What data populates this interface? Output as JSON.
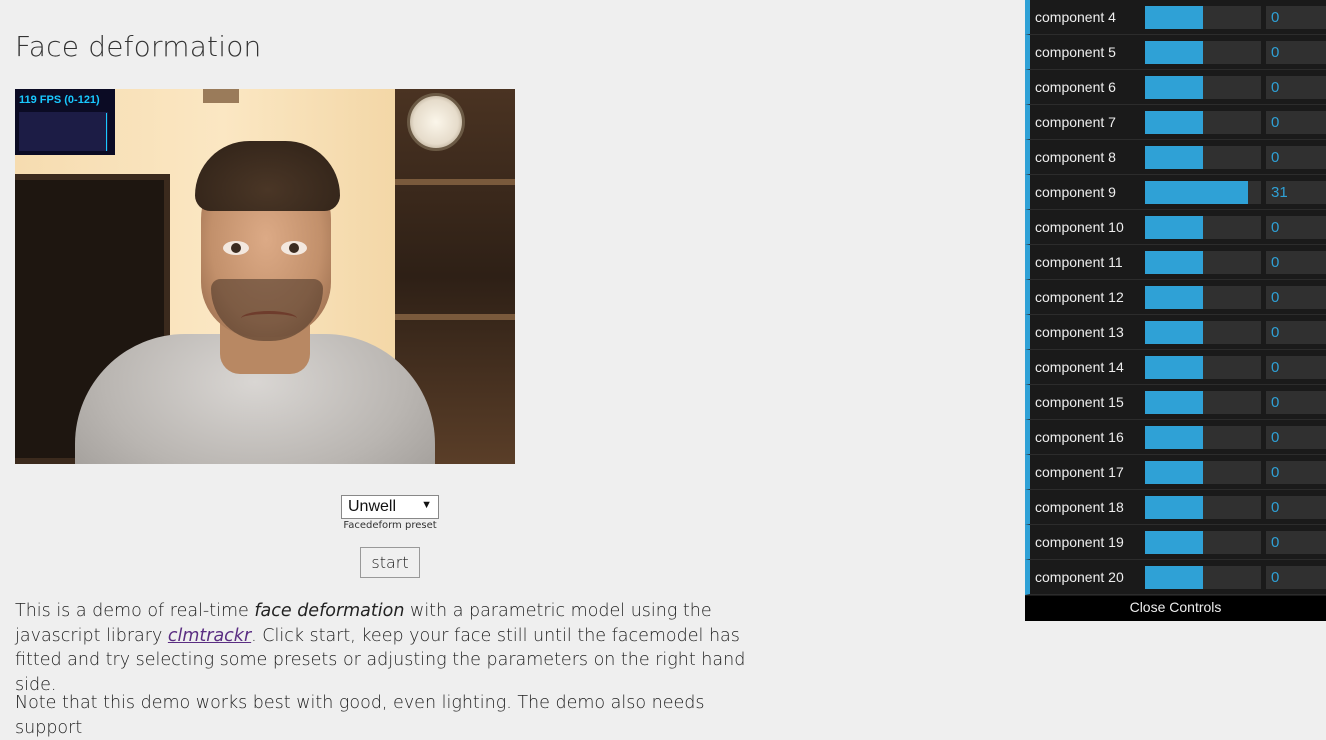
{
  "page": {
    "title": "Face deformation"
  },
  "stats": {
    "fps_label": "119 FPS (0-121)",
    "fps_level": 0.97
  },
  "preset": {
    "selected": "Unwell",
    "caption": "Facedeform preset"
  },
  "start_label": "start",
  "description": {
    "p1_a": "This is a demo of real-time ",
    "p1_em": "face deformation",
    "p1_b": " with a parametric model using the javascript library ",
    "p1_link": "clmtrackr",
    "p1_c": ". Click start, keep your face still until the facemodel has fitted and try selecting some presets or adjusting the parameters on the right hand side.",
    "p2": "Note that this demo works best with good, even lighting. The demo also needs support"
  },
  "controls": {
    "accent": "#2fa1d6",
    "close_label": "Close Controls",
    "components": [
      {
        "label": "component 4",
        "value": "0",
        "level": 0.5
      },
      {
        "label": "component 5",
        "value": "0",
        "level": 0.5
      },
      {
        "label": "component 6",
        "value": "0",
        "level": 0.5
      },
      {
        "label": "component 7",
        "value": "0",
        "level": 0.5
      },
      {
        "label": "component 8",
        "value": "0",
        "level": 0.5
      },
      {
        "label": "component 9",
        "value": "31",
        "level": 0.89
      },
      {
        "label": "component 10",
        "value": "0",
        "level": 0.5
      },
      {
        "label": "component 11",
        "value": "0",
        "level": 0.5
      },
      {
        "label": "component 12",
        "value": "0",
        "level": 0.5
      },
      {
        "label": "component 13",
        "value": "0",
        "level": 0.5
      },
      {
        "label": "component 14",
        "value": "0",
        "level": 0.5
      },
      {
        "label": "component 15",
        "value": "0",
        "level": 0.5
      },
      {
        "label": "component 16",
        "value": "0",
        "level": 0.5
      },
      {
        "label": "component 17",
        "value": "0",
        "level": 0.5
      },
      {
        "label": "component 18",
        "value": "0",
        "level": 0.5
      },
      {
        "label": "component 19",
        "value": "0",
        "level": 0.5
      },
      {
        "label": "component 20",
        "value": "0",
        "level": 0.5
      }
    ]
  }
}
